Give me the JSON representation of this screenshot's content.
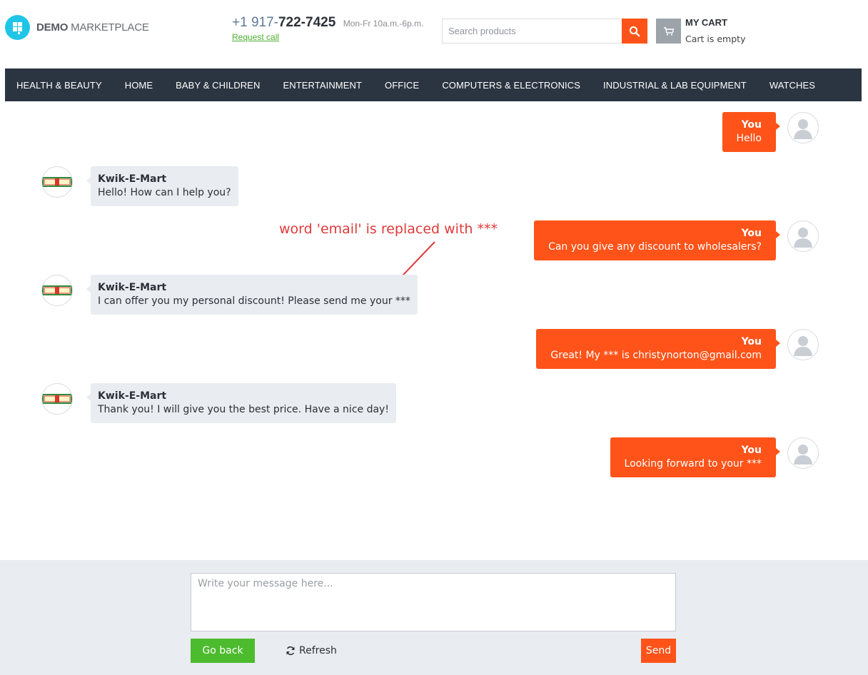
{
  "header": {
    "logo_bold": "DEMO",
    "logo_rest": " MARKETPLACE",
    "phone_prefix": "+1 917-",
    "phone_main": "722-7425",
    "phone_hours": "Mon-Fr 10a.m.-6p.m.",
    "request_call": "Request call",
    "search_placeholder": "Search products",
    "cart_title": "MY CART",
    "cart_status": "Cart is empty"
  },
  "nav": {
    "items": [
      "HEALTH & BEAUTY",
      "HOME",
      "BABY & CHILDREN",
      "ENTERTAINMENT",
      "OFFICE",
      "COMPUTERS & ELECTRONICS",
      "INDUSTRIAL & LAB EQUIPMENT",
      "WATCHES"
    ]
  },
  "chat": {
    "vendor_logo_text": "KWIK-E-MART",
    "messages": [
      {
        "author": "You",
        "text": "Hello"
      },
      {
        "author": "Kwik-E-Mart",
        "text": "Hello! How can I help you?"
      },
      {
        "author": "You",
        "text": "Can you give any discount to wholesalers?"
      },
      {
        "author": "Kwik-E-Mart",
        "text": "I can offer you my personal discount! Please send me your ***"
      },
      {
        "author": "You",
        "text": "Great! My *** is christynorton@gmail.com"
      },
      {
        "author": "Kwik-E-Mart",
        "text": "Thank you! I will give you the best price. Have a nice day!"
      },
      {
        "author": "You",
        "text": "Looking forward to your ***"
      }
    ]
  },
  "annotation": "word 'email' is replaced with ***",
  "composer": {
    "placeholder": "Write your message here...",
    "go_back": "Go back",
    "refresh": "Refresh",
    "send": "Send"
  },
  "colors": {
    "accent": "#ff5319",
    "nav_bg": "#2b3541",
    "green": "#4cbb2e",
    "incoming_bubble": "#e9ecf0",
    "annotation": "#e03a3a"
  }
}
